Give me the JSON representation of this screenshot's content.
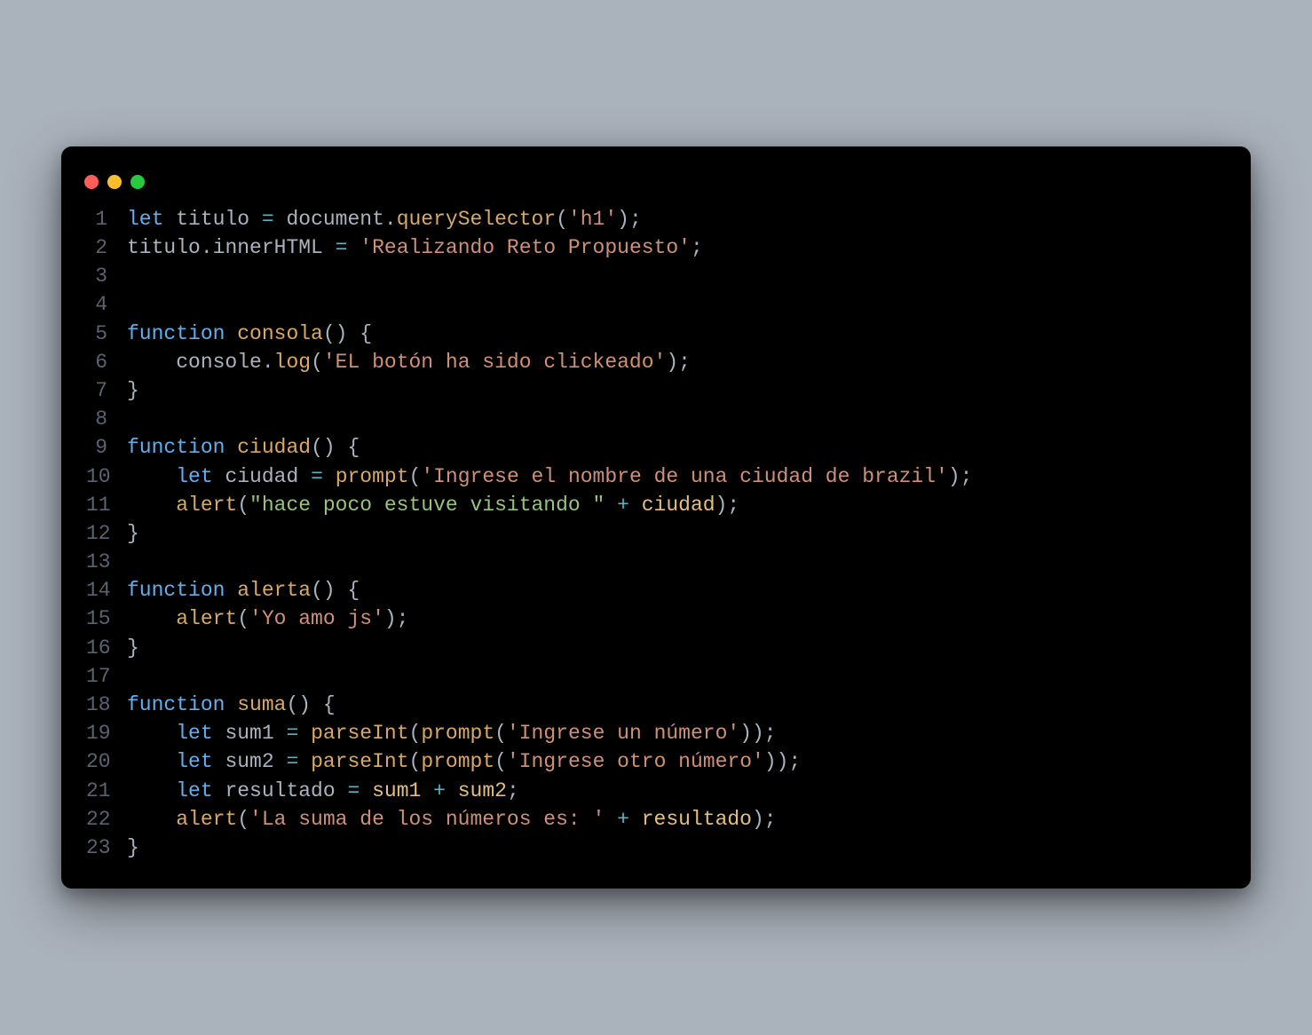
{
  "window": {
    "traffic_lights": [
      "red",
      "yellow",
      "green"
    ]
  },
  "code": {
    "lines": [
      {
        "n": 1,
        "tokens": [
          [
            "kw",
            "let "
          ],
          [
            "id",
            "titulo "
          ],
          [
            "op",
            "="
          ],
          [
            "id",
            " document"
          ],
          [
            "pun",
            "."
          ],
          [
            "fn",
            "querySelector"
          ],
          [
            "pun",
            "("
          ],
          [
            "str",
            "'h1'"
          ],
          [
            "pun",
            ");"
          ]
        ]
      },
      {
        "n": 2,
        "tokens": [
          [
            "id",
            "titulo"
          ],
          [
            "pun",
            "."
          ],
          [
            "id",
            "innerHTML "
          ],
          [
            "op",
            "="
          ],
          [
            "id",
            " "
          ],
          [
            "str",
            "'Realizando Reto Propuesto'"
          ],
          [
            "pun",
            ";"
          ]
        ]
      },
      {
        "n": 3,
        "tokens": []
      },
      {
        "n": 4,
        "tokens": []
      },
      {
        "n": 5,
        "tokens": [
          [
            "kw",
            "function "
          ],
          [
            "fn",
            "consola"
          ],
          [
            "pun",
            "() {"
          ]
        ]
      },
      {
        "n": 6,
        "tokens": [
          [
            "id",
            "    console"
          ],
          [
            "pun",
            "."
          ],
          [
            "fn",
            "log"
          ],
          [
            "pun",
            "("
          ],
          [
            "str",
            "'EL botón ha sido clickeado'"
          ],
          [
            "pun",
            ");"
          ]
        ]
      },
      {
        "n": 7,
        "tokens": [
          [
            "pun",
            "}"
          ]
        ]
      },
      {
        "n": 8,
        "tokens": []
      },
      {
        "n": 9,
        "tokens": [
          [
            "kw",
            "function "
          ],
          [
            "fn",
            "ciudad"
          ],
          [
            "pun",
            "() {"
          ]
        ]
      },
      {
        "n": 10,
        "tokens": [
          [
            "id",
            "    "
          ],
          [
            "kw",
            "let "
          ],
          [
            "id",
            "ciudad "
          ],
          [
            "op",
            "="
          ],
          [
            "id",
            " "
          ],
          [
            "fn",
            "prompt"
          ],
          [
            "pun",
            "("
          ],
          [
            "str",
            "'Ingrese el nombre de una ciudad de brazil'"
          ],
          [
            "pun",
            ");"
          ]
        ]
      },
      {
        "n": 11,
        "tokens": [
          [
            "id",
            "    "
          ],
          [
            "fn",
            "alert"
          ],
          [
            "pun",
            "("
          ],
          [
            "str2",
            "\"hace poco estuve visitando \""
          ],
          [
            "id",
            " "
          ],
          [
            "op",
            "+"
          ],
          [
            "id",
            " "
          ],
          [
            "var",
            "ciudad"
          ],
          [
            "pun",
            ");"
          ]
        ]
      },
      {
        "n": 12,
        "tokens": [
          [
            "pun",
            "}"
          ]
        ]
      },
      {
        "n": 13,
        "tokens": []
      },
      {
        "n": 14,
        "tokens": [
          [
            "kw",
            "function "
          ],
          [
            "fn",
            "alerta"
          ],
          [
            "pun",
            "() {"
          ]
        ]
      },
      {
        "n": 15,
        "tokens": [
          [
            "id",
            "    "
          ],
          [
            "fn",
            "alert"
          ],
          [
            "pun",
            "("
          ],
          [
            "str",
            "'Yo amo js'"
          ],
          [
            "pun",
            ");"
          ]
        ]
      },
      {
        "n": 16,
        "tokens": [
          [
            "pun",
            "}"
          ]
        ]
      },
      {
        "n": 17,
        "tokens": []
      },
      {
        "n": 18,
        "tokens": [
          [
            "kw",
            "function "
          ],
          [
            "fn",
            "suma"
          ],
          [
            "pun",
            "() {"
          ]
        ]
      },
      {
        "n": 19,
        "tokens": [
          [
            "id",
            "    "
          ],
          [
            "kw",
            "let "
          ],
          [
            "id",
            "sum1 "
          ],
          [
            "op",
            "="
          ],
          [
            "id",
            " "
          ],
          [
            "fn",
            "parseInt"
          ],
          [
            "pun",
            "("
          ],
          [
            "fn",
            "prompt"
          ],
          [
            "pun",
            "("
          ],
          [
            "str",
            "'Ingrese un número'"
          ],
          [
            "pun",
            "));"
          ]
        ]
      },
      {
        "n": 20,
        "tokens": [
          [
            "id",
            "    "
          ],
          [
            "kw",
            "let "
          ],
          [
            "id",
            "sum2 "
          ],
          [
            "op",
            "="
          ],
          [
            "id",
            " "
          ],
          [
            "fn",
            "parseInt"
          ],
          [
            "pun",
            "("
          ],
          [
            "fn",
            "prompt"
          ],
          [
            "pun",
            "("
          ],
          [
            "str",
            "'Ingrese otro número'"
          ],
          [
            "pun",
            "));"
          ]
        ]
      },
      {
        "n": 21,
        "tokens": [
          [
            "id",
            "    "
          ],
          [
            "kw",
            "let "
          ],
          [
            "id",
            "resultado "
          ],
          [
            "op",
            "="
          ],
          [
            "id",
            " "
          ],
          [
            "var",
            "sum1"
          ],
          [
            "id",
            " "
          ],
          [
            "op",
            "+"
          ],
          [
            "id",
            " "
          ],
          [
            "var",
            "sum2"
          ],
          [
            "pun",
            ";"
          ]
        ]
      },
      {
        "n": 22,
        "tokens": [
          [
            "id",
            "    "
          ],
          [
            "fn",
            "alert"
          ],
          [
            "pun",
            "("
          ],
          [
            "str",
            "'La suma de los números es: '"
          ],
          [
            "id",
            " "
          ],
          [
            "op",
            "+"
          ],
          [
            "id",
            " "
          ],
          [
            "var",
            "resultado"
          ],
          [
            "pun",
            ");"
          ]
        ]
      },
      {
        "n": 23,
        "tokens": [
          [
            "pun",
            "}"
          ]
        ]
      }
    ]
  }
}
